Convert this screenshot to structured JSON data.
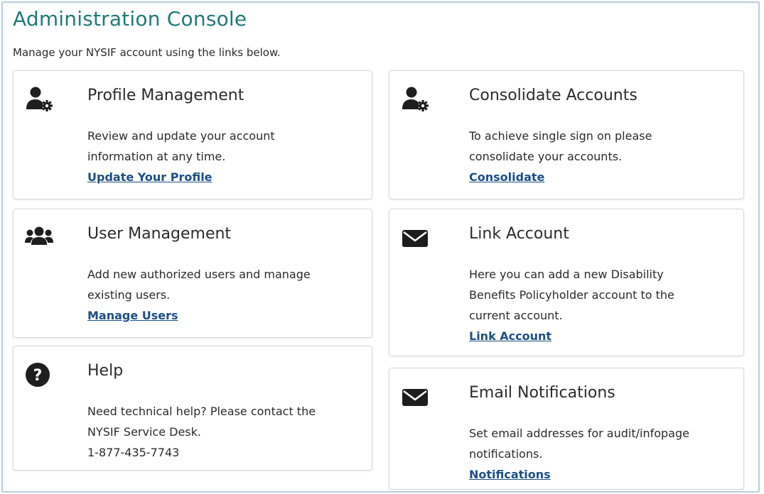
{
  "page": {
    "title": "Administration Console",
    "subtitle": "Manage your NYSIF account using the links below."
  },
  "cards": {
    "profile": {
      "icon": "user-gear-icon",
      "title": "Profile Management",
      "lines": [
        "Review and update your account",
        "information at any time."
      ],
      "link": "Update Your Profile"
    },
    "consolidate": {
      "icon": "user-gear-icon",
      "title": "Consolidate Accounts",
      "lines": [
        "To achieve single sign on please",
        "consolidate your accounts."
      ],
      "link": "Consolidate"
    },
    "users": {
      "icon": "users-icon",
      "title": "User Management",
      "lines": [
        "Add new authorized users and manage",
        "existing users."
      ],
      "link": "Manage Users"
    },
    "link_account": {
      "icon": "envelope-icon",
      "title": "Link Account",
      "lines": [
        "Here you can add a new Disability",
        "Benefits Policyholder account to the",
        "current account."
      ],
      "link": "Link Account"
    },
    "help": {
      "icon": "question-circle-icon",
      "title": "Help",
      "lines": [
        "Need technical help? Please contact the",
        "NYSIF Service Desk.",
        "1-877-435-7743"
      ]
    },
    "email": {
      "icon": "envelope-icon",
      "title": "Email Notifications",
      "lines": [
        "Set email addresses for audit/infopage",
        "notifications."
      ],
      "link": "Notifications"
    }
  },
  "colors": {
    "title": "#1f7a78",
    "link": "#1d4f86",
    "frame_border": "#b9cfe3",
    "card_border": "#d9d9d9"
  }
}
